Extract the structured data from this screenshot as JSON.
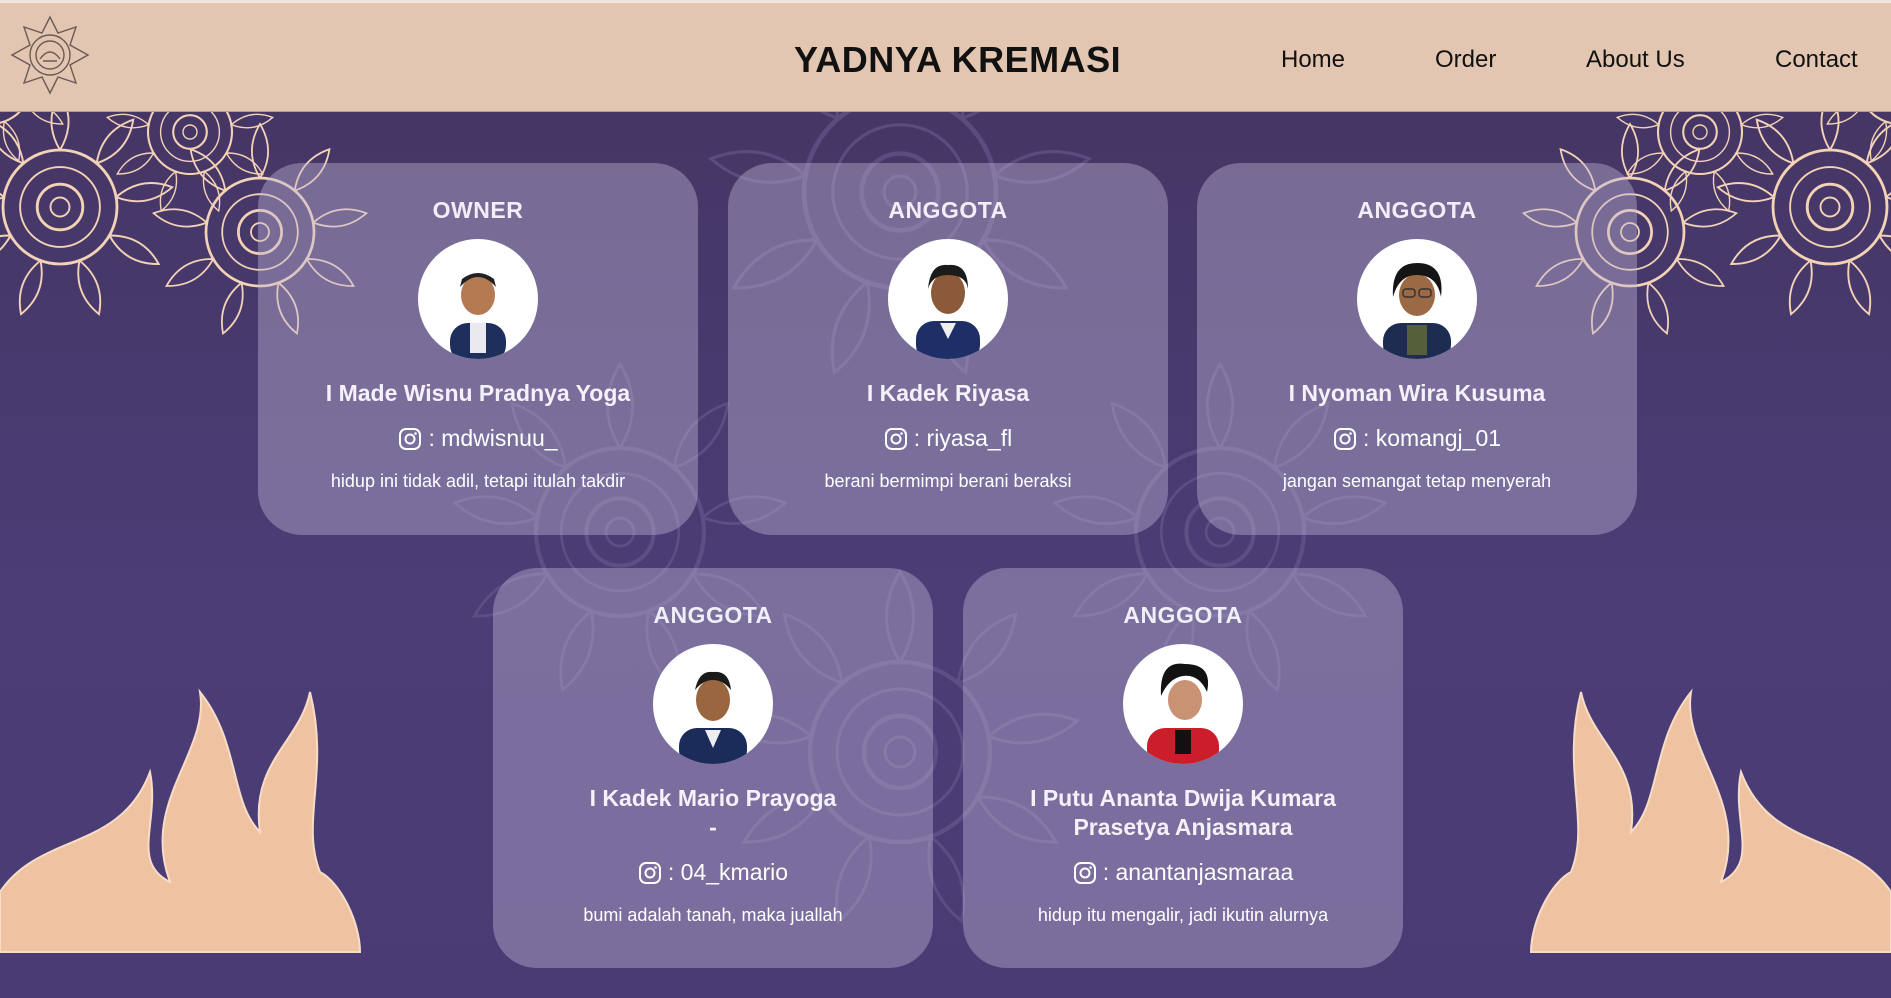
{
  "header": {
    "brand": "YADNYA KREMASI",
    "nav": [
      "Home",
      "Order",
      "About Us",
      "Contact"
    ]
  },
  "colors": {
    "header_bg": "#e2c6b1",
    "page_bg": "#4a3b74",
    "ornament": "#f3d2b6",
    "card_bg": "rgba(190,180,215,0.42)"
  },
  "members": [
    {
      "role": "OWNER",
      "name": "I Made Wisnu Pradnya Yoga",
      "instagram": ": mdwisnuu_",
      "quote": "hidup ini tidak adil, tetapi itulah takdir"
    },
    {
      "role": "ANGGOTA",
      "name": "I Kadek Riyasa",
      "instagram": ": riyasa_fl",
      "quote": "berani bermimpi berani beraksi"
    },
    {
      "role": "ANGGOTA",
      "name": "I Nyoman Wira Kusuma",
      "instagram": ": komangj_01",
      "quote": "jangan semangat tetap menyerah"
    },
    {
      "role": "ANGGOTA",
      "name": "I Kadek Mario Prayoga",
      "name_line2": "-",
      "instagram": ": 04_kmario",
      "quote": "bumi adalah tanah, maka juallah"
    },
    {
      "role": "ANGGOTA",
      "name": "I Putu Ananta Dwija Kumara",
      "name_line2": "Prasetya Anjasmara",
      "instagram": ": anantanjasmaraa",
      "quote": "hidup itu mengalir, jadi ikutin alurnya"
    }
  ]
}
